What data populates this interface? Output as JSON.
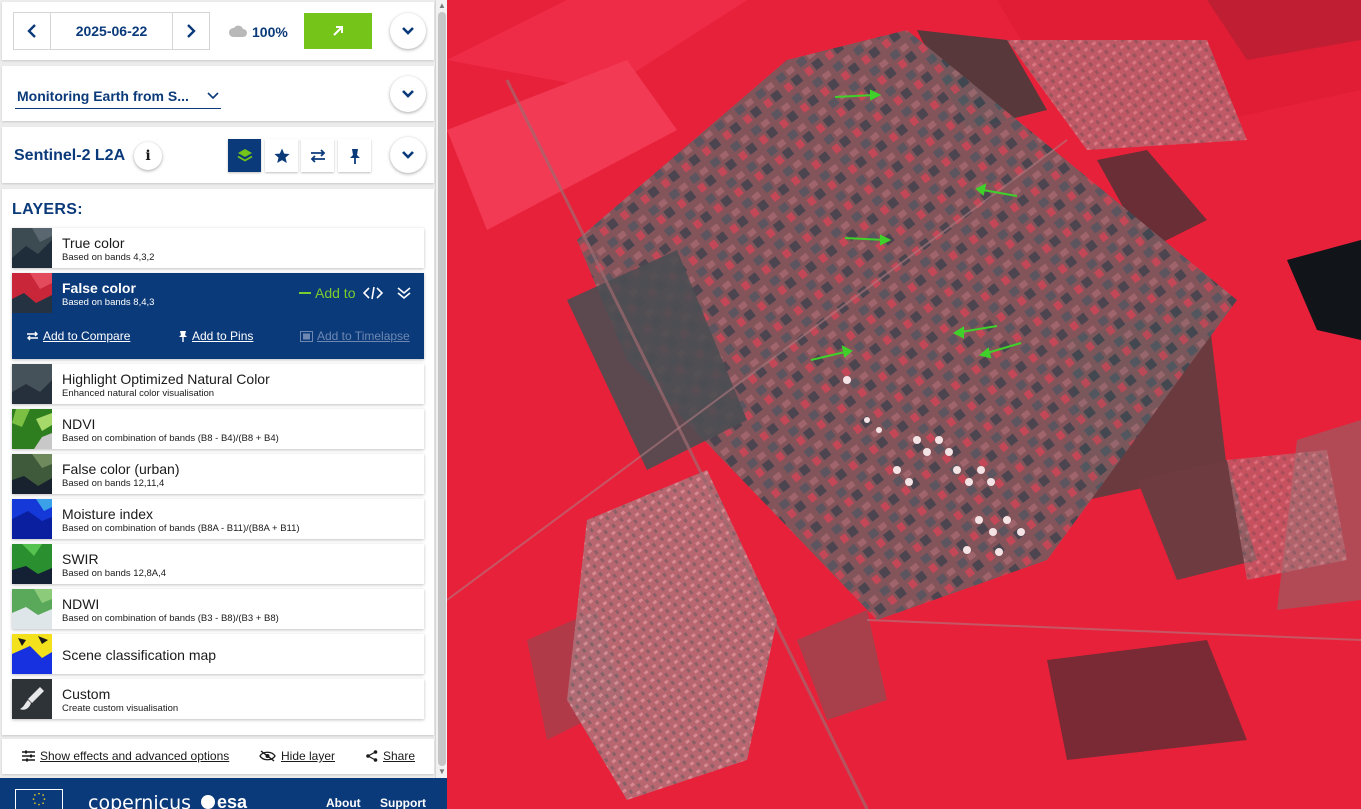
{
  "date_bar": {
    "date": "2025-06-22",
    "cloud_coverage": "100%",
    "prev_icon": "chevron-left-icon",
    "next_icon": "chevron-right-icon",
    "search_icon": "arrow-up-right-icon"
  },
  "theme": {
    "selected": "Monitoring Earth from S..."
  },
  "dataset": {
    "title": "Sentinel-2 L2A",
    "info_label": "i"
  },
  "layers": {
    "heading": "LAYERS:",
    "items": [
      {
        "title": "True color",
        "description": "Based on bands 4,3,2"
      },
      {
        "title": "False color",
        "description": "Based on bands 8,4,3"
      },
      {
        "title": "Highlight Optimized Natural Color",
        "description": "Enhanced natural color visualisation"
      },
      {
        "title": "NDVI",
        "description": "Based on combination of bands (B8 - B4)/(B8 + B4)"
      },
      {
        "title": "False color (urban)",
        "description": "Based on bands 12,11,4"
      },
      {
        "title": "Moisture index",
        "description": "Based on combination of bands (B8A - B11)/(B8A + B11)"
      },
      {
        "title": "SWIR",
        "description": "Based on bands 12,8A,4"
      },
      {
        "title": "NDWI",
        "description": "Based on combination of bands (B3 - B8)/(B3 + B8)"
      },
      {
        "title": "Scene classification map",
        "description": ""
      },
      {
        "title": "Custom",
        "description": "Create custom visualisation"
      }
    ],
    "selected_actions": {
      "add_to": "Add to",
      "compare": "Add to Compare",
      "pins": "Add to Pins",
      "timelapse": "Add to Timelapse"
    }
  },
  "bottom_bar": {
    "effects": "Show effects and advanced options",
    "hide": "Hide layer",
    "share": "Share"
  },
  "footer": {
    "copernicus": "copernicus",
    "esa": "esa",
    "about": "About",
    "support": "Support"
  },
  "colors": {
    "brand_blue": "#0b3a7a",
    "accent_green": "#75c41a",
    "map_red": "#e8213a"
  }
}
